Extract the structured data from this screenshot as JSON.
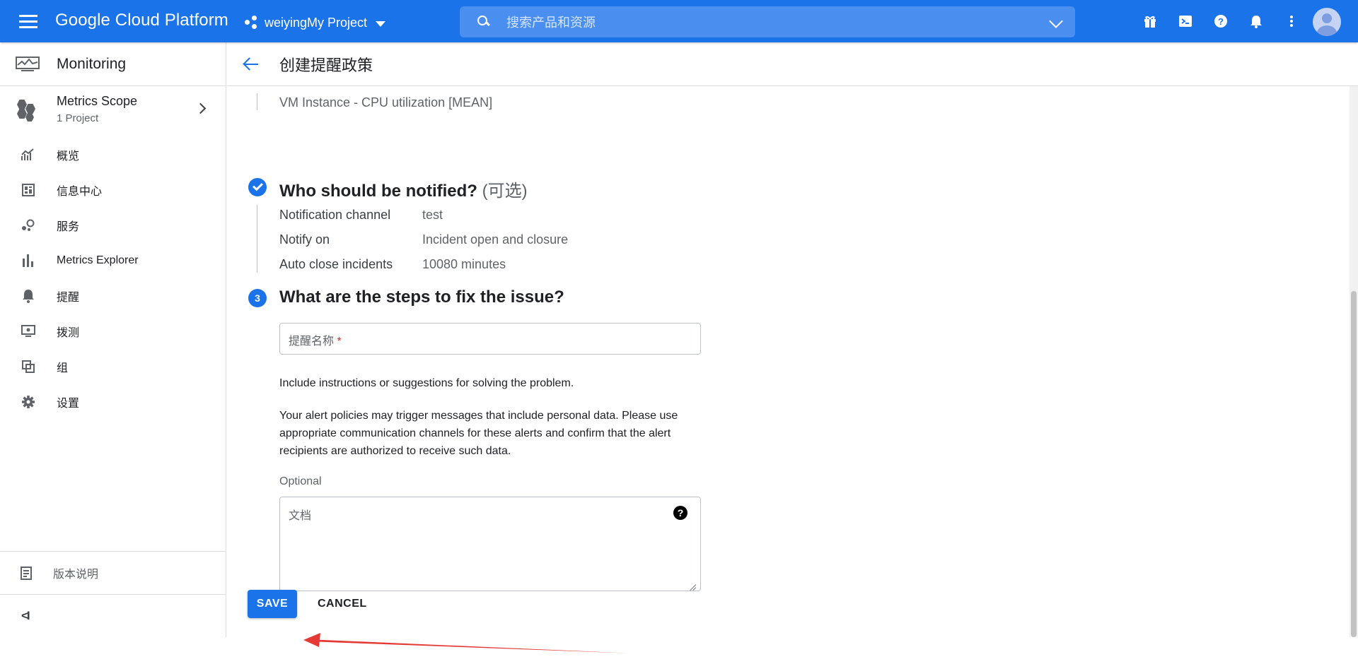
{
  "topbar": {
    "brand": "Google Cloud Platform",
    "project": "weiyingMy Project",
    "search_placeholder": "搜索产品和资源",
    "icons": [
      "menu-icon",
      "gift-icon",
      "terminal-icon",
      "help-icon",
      "bell-icon",
      "more-vert-icon",
      "account-avatar"
    ]
  },
  "sidebar": {
    "title": "Monitoring",
    "scope": {
      "title": "Metrics Scope",
      "subtitle": "1 Project"
    },
    "items": [
      {
        "label": "概览",
        "icon": "chart-icon"
      },
      {
        "label": "信息中心",
        "icon": "dashboard-icon"
      },
      {
        "label": "服务",
        "icon": "services-icon"
      },
      {
        "label": "Metrics Explorer",
        "icon": "bar-chart-icon"
      },
      {
        "label": "提醒",
        "icon": "bell-icon"
      },
      {
        "label": "拨测",
        "icon": "uptime-icon"
      },
      {
        "label": "组",
        "icon": "groups-icon"
      },
      {
        "label": "设置",
        "icon": "gear-icon"
      }
    ],
    "release_notes": "版本说明",
    "collapse_label": "<I"
  },
  "page": {
    "title": "创建提醒政策",
    "prev_summary": "VM Instance - CPU utilization [MEAN]",
    "step2": {
      "title": "Who should be notified?",
      "optional": "(可选)",
      "rows": [
        {
          "key": "Notification channel",
          "value": "test"
        },
        {
          "key": "Notify on",
          "value": "Incident open and closure"
        },
        {
          "key": "Auto close incidents",
          "value": "10080 minutes"
        }
      ]
    },
    "step3": {
      "number": "3",
      "title": "What are the steps to fix the issue?",
      "name_placeholder": "提醒名称",
      "required_mark": "*",
      "instructions": "Include instructions or suggestions for solving the problem.",
      "privacy": "Your alert policies may trigger messages that include personal data. Please use appropriate communication channels for these alerts and confirm that the alert recipients are authorized to receive such data.",
      "optional_label": "Optional",
      "doc_placeholder": "文档",
      "help_glyph": "?"
    },
    "actions": {
      "save": "SAVE",
      "cancel": "CANCEL"
    },
    "colors": {
      "primary": "#1a73e8",
      "annotation_arrow": "#e53935"
    }
  }
}
